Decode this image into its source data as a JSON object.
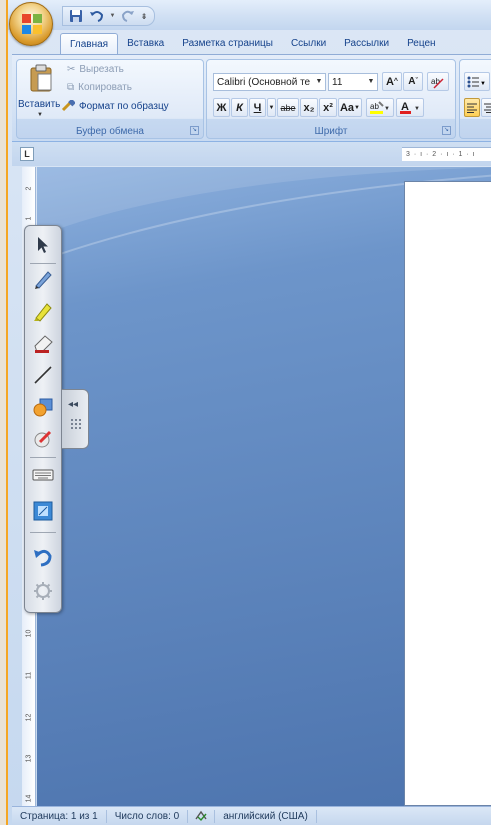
{
  "tabs": [
    "Главная",
    "Вставка",
    "Разметка страницы",
    "Ссылки",
    "Рассылки",
    "Рецен"
  ],
  "clipboard": {
    "cut": "Вырезать",
    "copy": "Копировать",
    "paste": "Вставить",
    "format_painter": "Формат по образцу",
    "group_label": "Буфер обмена"
  },
  "font": {
    "family": "Calibri (Основной те",
    "size": "11",
    "group_label": "Шрифт",
    "bold": "Ж",
    "italic": "К",
    "underline": "Ч",
    "strike": "abe",
    "subscript": "x₂",
    "superscript": "x²",
    "case": "Aa",
    "grow": "A",
    "shrink": "A"
  },
  "hruler_text": "3 · ı · 2 · ı · 1 · ı",
  "vruler": [
    "2",
    "1",
    "1",
    "2",
    "3",
    "4",
    "5",
    "6",
    "7",
    "8",
    "9",
    "10",
    "11",
    "12",
    "13",
    "14",
    "15"
  ],
  "status": {
    "page": "Страница: 1 из 1",
    "words": "Число слов: 0",
    "language": "английский (США)"
  },
  "colors": {
    "accent_border": "#f5a623",
    "ribbon": "#d5e3f5",
    "doc_bg": "#5b82bb"
  }
}
